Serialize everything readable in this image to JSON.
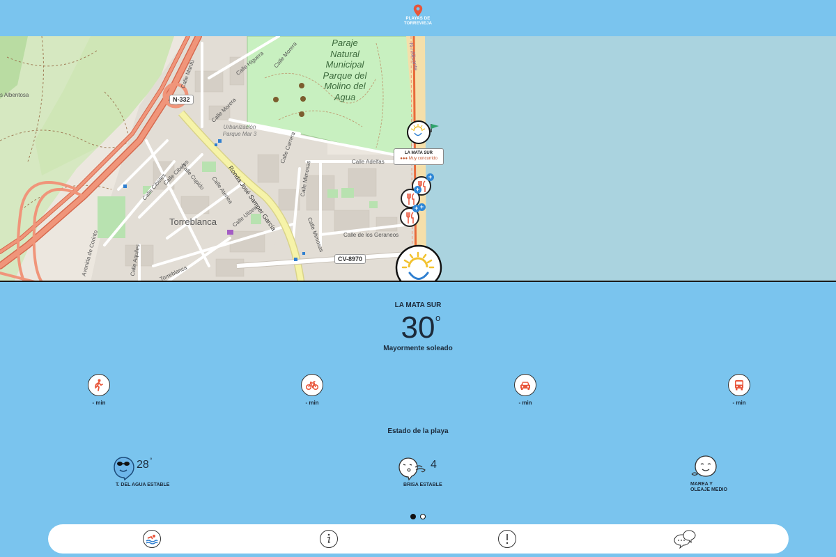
{
  "header": {
    "app_name": "PLAYAS DE TORREVIEJA"
  },
  "map": {
    "road_n332": "N-332",
    "road_cv8970": "CV-8970",
    "park_name": "Paraje Natural Municipal Parque del Molino del Agua",
    "town": "Torreblanca",
    "urbanization": "Urbanización Parque Mar 3",
    "streets": {
      "morera_top": "Calle Morera",
      "higuera": "Calle Higuera",
      "morera": "Calle Morera",
      "manfu": "Calle Manfú",
      "carrera": "Calle Carrera",
      "adelfas": "Calle Adelfas",
      "mimosas": "Calle Mimosas",
      "ronda": "Ronda José Samper García",
      "geraneos": "Calle de los Geraneos",
      "cibeles": "Calle Cibeles",
      "cupido": "Calle Cupido",
      "atenea": "Calle Atenea",
      "ulises": "Calle Ulises",
      "aquiles": "Calle Aquiles",
      "corinto": "Avenida de Corinto",
      "albentosa": "s Albentosa",
      "torreblanca_st": "Torreblanca",
      "alicante": "N / Alicante"
    },
    "popup": {
      "title": "LA MATA SUR",
      "status": "Muy concurrido"
    }
  },
  "beach": {
    "name": "LA MATA SUR",
    "temperature": "30",
    "temperature_unit": "o",
    "condition": "Mayormente soleado"
  },
  "transport": [
    {
      "mode": "walk",
      "icon": "walk-icon",
      "label": "- min"
    },
    {
      "mode": "bike",
      "icon": "bike-icon",
      "label": "- min"
    },
    {
      "mode": "car",
      "icon": "car-icon",
      "label": "- min"
    },
    {
      "mode": "bus",
      "icon": "bus-icon",
      "label": "- min"
    }
  ],
  "beach_status": {
    "title": "Estado de la playa",
    "water": {
      "value": "28",
      "unit": "°",
      "label": "T. DEL AGUA ESTABLE"
    },
    "wind": {
      "value": "4",
      "label": "BRISA ESTABLE"
    },
    "tide": {
      "label_line1": "MAREA Y",
      "label_line2": "OLEAJE MEDIO"
    }
  },
  "pagination": {
    "total": 2,
    "active": 1
  },
  "colors": {
    "sky": "#7ac4ee",
    "accent_orange": "#e8553a",
    "sea": "#aad3df",
    "park": "#c8f0c0",
    "road_main": "#f0957a",
    "road_yellow": "#f6f3a8"
  }
}
